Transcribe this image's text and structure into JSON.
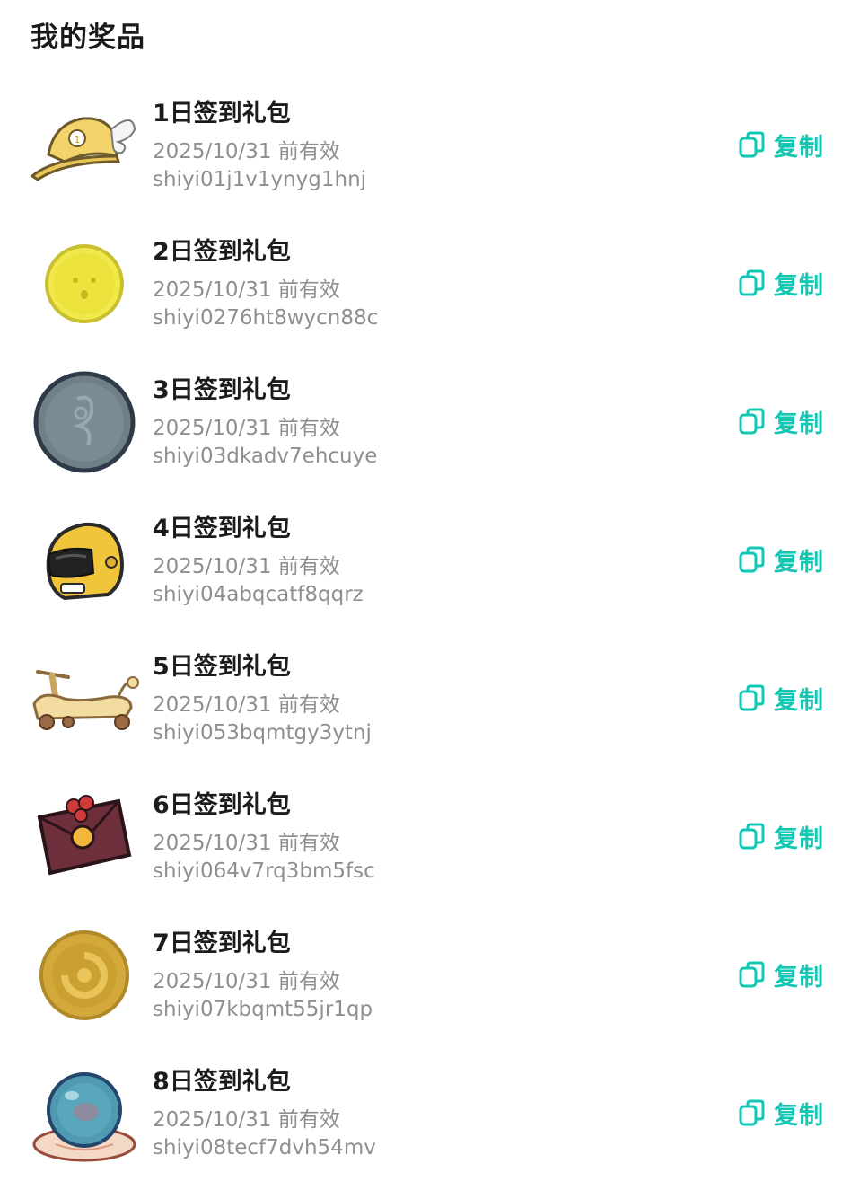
{
  "header": {
    "title": "我的奖品"
  },
  "accent_color": "#12c7b3",
  "prizes": [
    {
      "name": "1日签到礼包",
      "expiry": "2025/10/31 前有效",
      "code": "shiyi01j1v1ynyg1hnj",
      "icon": "winged-cap-icon",
      "copy_label": "复制"
    },
    {
      "name": "2日签到礼包",
      "expiry": "2025/10/31 前有效",
      "code": "shiyi0276ht8wycn88c",
      "icon": "yellow-face-coin-icon",
      "copy_label": "复制"
    },
    {
      "name": "3日签到礼包",
      "expiry": "2025/10/31 前有效",
      "code": "shiyi03dkadv7ehcuye",
      "icon": "gray-emblem-coin-icon",
      "copy_label": "复制"
    },
    {
      "name": "4日签到礼包",
      "expiry": "2025/10/31 前有效",
      "code": "shiyi04abqcatf8qqrz",
      "icon": "motorcycle-helmet-icon",
      "copy_label": "复制"
    },
    {
      "name": "5日签到礼包",
      "expiry": "2025/10/31 前有效",
      "code": "shiyi053bqmtgy3ytnj",
      "icon": "scooter-icon",
      "copy_label": "复制"
    },
    {
      "name": "6日签到礼包",
      "expiry": "2025/10/31 前有效",
      "code": "shiyi064v7rq3bm5fsc",
      "icon": "gift-envelope-icon",
      "copy_label": "复制"
    },
    {
      "name": "7日签到礼包",
      "expiry": "2025/10/31 前有效",
      "code": "shiyi07kbqmt55jr1qp",
      "icon": "gold-coin-icon",
      "copy_label": "复制"
    },
    {
      "name": "8日签到礼包",
      "expiry": "2025/10/31 前有效",
      "code": "shiyi08tecf7dvh54mv",
      "icon": "crystal-ball-icon",
      "copy_label": "复制"
    }
  ]
}
